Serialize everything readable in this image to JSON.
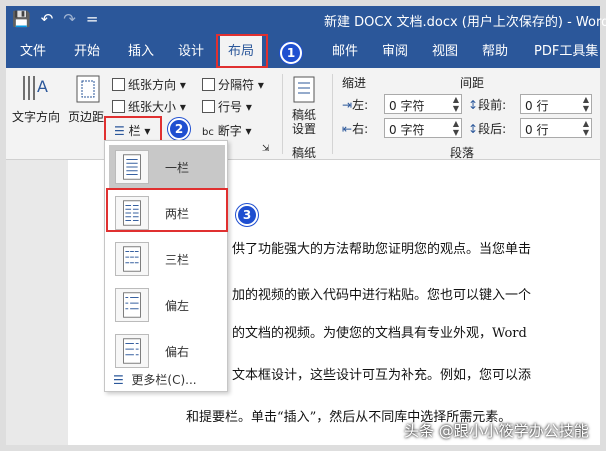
{
  "window": {
    "title": "新建 DOCX 文档.docx (用户上次保存的) - Word"
  },
  "qat": {
    "save_icon": "💾",
    "undo_icon": "↶",
    "redo_icon": "↷",
    "customize_icon": "="
  },
  "tabs": [
    "文件",
    "开始",
    "插入",
    "设计",
    "布局",
    "邮件",
    "审阅",
    "视图",
    "帮助",
    "PDF工具集"
  ],
  "badges": [
    "1",
    "2",
    "3"
  ],
  "ribbon": {
    "page_setup": {
      "text_direction": "文字方向",
      "margins": "页边距",
      "orientation": "纸张方向",
      "size": "纸张大小",
      "columns": "栏",
      "breaks": "分隔符",
      "line_numbers": "行号",
      "hyphenation": "断字"
    },
    "draft": {
      "button": "稿纸设置",
      "group": "稿纸"
    },
    "indent": {
      "title": "缩进",
      "left_label": "左:",
      "left_value": "0 字符",
      "right_label": "右:",
      "right_value": "0 字符"
    },
    "spacing": {
      "title": "间距",
      "before_label": "段前:",
      "before_value": "0 行",
      "after_label": "段后:",
      "after_value": "0 行"
    },
    "paragraph_group": "段落"
  },
  "columns_menu": {
    "items": [
      "一栏",
      "两栏",
      "三栏",
      "偏左",
      "偏右"
    ],
    "more": "更多栏(C)..."
  },
  "document": {
    "lines": [
      "供了功能强大的方法帮助您证明您的观点。当您单击",
      "加的视频的嵌入代码中进行粘贴。您也可以键入一个",
      "的文档的视频。为使您的文档具有专业外观，Word",
      "文本框设计，这些设计可互为补充。例如，您可以添",
      "和提要栏。单击“插入”，然后从不同库中选择所需元素。"
    ]
  },
  "watermark": "头条 @跟小小筱学办公技能",
  "colors": {
    "brand": "#2b579a",
    "highlight": "#e03030",
    "badge": "#1f4fd0"
  }
}
